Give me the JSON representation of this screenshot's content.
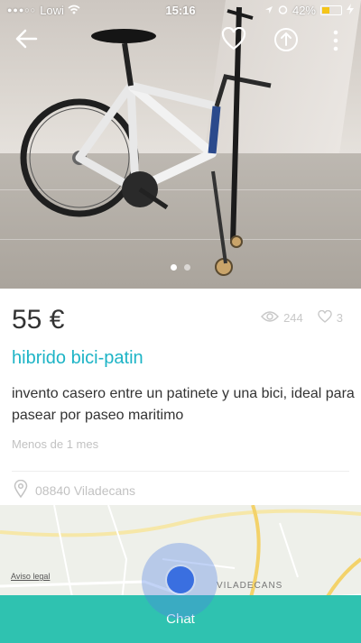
{
  "status_bar": {
    "carrier": "Lowi",
    "time": "15:16",
    "battery": "42%",
    "battery_level": 0.42
  },
  "photo": {
    "dot_count": 2,
    "active_dot": 0
  },
  "listing": {
    "price": "55 €",
    "views": "244",
    "favorites": "3",
    "title": "hibrido bici-patin",
    "description": "invento casero entre un patinete y una bici, ideal para pasear por paseo maritimo",
    "posted": "Menos de 1 mes",
    "location": "08840 Viladecans"
  },
  "map": {
    "legal_link": "Aviso legal",
    "place_label": "VILADECANS"
  },
  "actions": {
    "chat_label": "Chat"
  },
  "colors": {
    "accent": "#1db4c6",
    "chat_bar": "#2fc2b0",
    "location_dot": "#3a6fe0"
  }
}
